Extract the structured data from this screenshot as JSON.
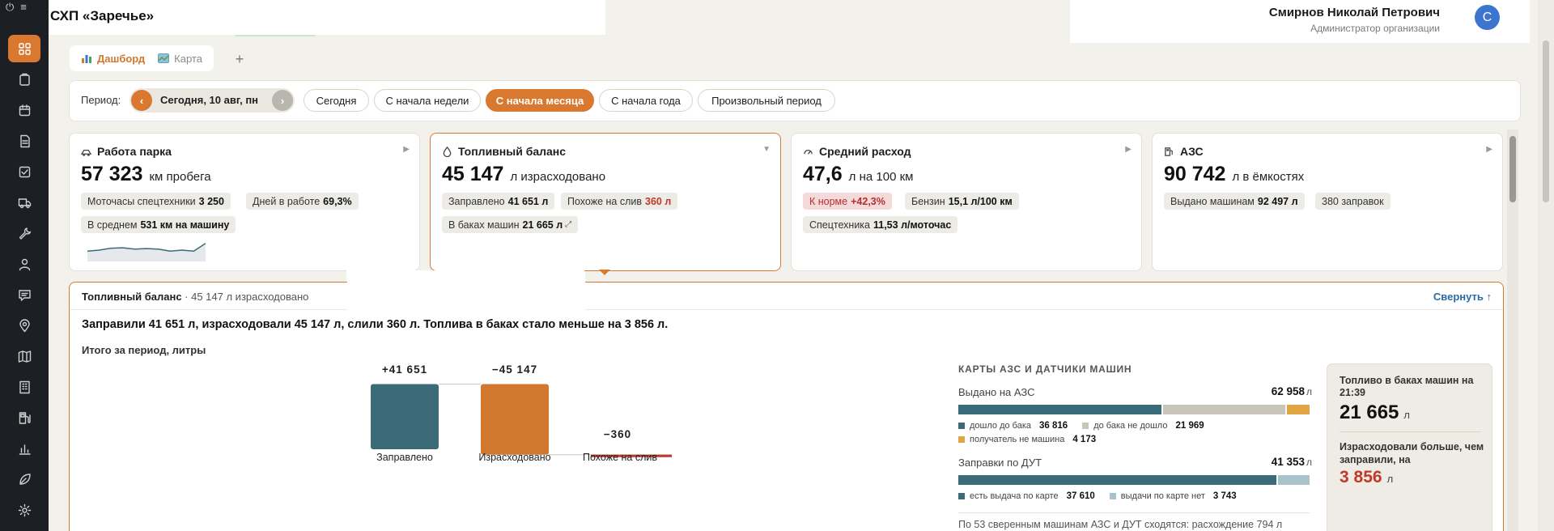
{
  "org": {
    "title": "СХП «Заречье»"
  },
  "user": {
    "name": "Смирнов Николай Петрович",
    "role": "Администратор организации",
    "avatar_letter": "С"
  },
  "sidebar": {
    "icons": [
      "dashboard-icon",
      "clipboard-icon",
      "calendar-icon",
      "document-icon",
      "checklist-icon",
      "truck-icon",
      "wrench-icon",
      "user-icon",
      "chat-icon",
      "location-icon",
      "map-icon",
      "building-icon",
      "fuel-station-icon",
      "bar-chart-icon",
      "leaf-icon",
      "settings-icon"
    ],
    "accent": "#d9782f"
  },
  "tabs": [
    {
      "label": "Дашборд",
      "icon": "bar-chart-icon",
      "active": true
    },
    {
      "label": "Карта",
      "icon": "map-icon",
      "active": false
    }
  ],
  "add_tab_label": "+",
  "period": {
    "label": "Период:",
    "current": "Сегодня, 10 авг, пн",
    "prev": "‹",
    "next": "›",
    "options": [
      "Сегодня",
      "С начала недели",
      "С начала месяца",
      "С начала года",
      "Произвольный период"
    ],
    "active": "С начала месяца"
  },
  "cards": [
    {
      "title": "Работа парка",
      "icon": "fleet-icon",
      "value": "57 323",
      "unit": "км пробега",
      "chips": [
        {
          "label": "Моточасы спецтехники",
          "value": "3 250"
        },
        {
          "label": "Дней в работе",
          "value": "69,3%"
        },
        {
          "label": "В среднем",
          "value": "531 км на машину"
        }
      ],
      "sparkline": [
        0.45,
        0.5,
        0.6,
        0.62,
        0.55,
        0.58,
        0.55,
        0.45,
        0.5,
        0.45,
        0.85
      ]
    },
    {
      "title": "Топливный баланс",
      "icon": "drop-icon",
      "value": "45 147",
      "unit": "л израсходовано",
      "chips": [
        {
          "label": "Заправлено",
          "value": "41 651 л"
        },
        {
          "label": "Похоже на слив",
          "value": "360 л"
        },
        {
          "label": "В баках машин",
          "value": "21 665 л",
          "suffix": "⤢"
        }
      ]
    },
    {
      "title": "Средний расход",
      "icon": "gauge-icon",
      "value": "47,6",
      "unit": "л на 100 км",
      "chips": [
        {
          "label": "К норме",
          "value": "+42,3%"
        },
        {
          "label": "Бензин",
          "value": "15,1 л/100 км"
        },
        {
          "label": "Спецтехника",
          "value": "11,53 л/моточас"
        }
      ]
    },
    {
      "title": "АЗС",
      "icon": "fuel-pump-icon",
      "value": "90 742",
      "unit": "л в ёмкостях",
      "chips": [
        {
          "label": "Выдано машинам",
          "value": "92 497 л"
        },
        {
          "label": "380 заправок",
          "value": ""
        }
      ]
    }
  ],
  "detail": {
    "title": "Топливный баланс",
    "subtitle": "· 45 147 л израсходовано",
    "collapse": "Свернуть ↑",
    "summary": "Заправили 41 651 л, израсходовали 45 147 л, слили 360 л. Топлива в баках стало меньше на 3 856 л.",
    "chart_title": "Итого за период, литры",
    "chart_data": {
      "type": "bar",
      "categories": [
        "Заправлено",
        "Израсходовано",
        "Похоже на слив"
      ],
      "values": [
        41651,
        -45147,
        -360
      ],
      "value_labels": [
        "+41 651",
        "−45 147",
        "−360"
      ],
      "colors": [
        "#3b6a78",
        "#d1772e",
        "#c0392b"
      ]
    },
    "right_panel": {
      "title": "КАРТЫ АЗС И ДАТЧИКИ МАШИН",
      "block1": {
        "label": "Выдано на АЗС",
        "total": "62 958",
        "unit": "л",
        "segments": [
          36816,
          21969,
          4173
        ],
        "legend": [
          {
            "label": "дошло до бака",
            "value": "36 816",
            "color": "#3b6a78"
          },
          {
            "label": "до бака не дошло",
            "value": "21 969",
            "color": "#c9c5bb"
          },
          {
            "label": "получатель не машина",
            "value": "4 173",
            "color": "#e0a443"
          }
        ]
      },
      "block2": {
        "label": "Заправки по ДУТ",
        "total": "41 353",
        "unit": "л",
        "segments": [
          37610,
          3743
        ],
        "legend": [
          {
            "label": "есть выдача по карте",
            "value": "37 610",
            "color": "#3b6a78"
          },
          {
            "label": "выдачи по карте нет",
            "value": "3 743",
            "color": "#a9c3cc"
          }
        ]
      },
      "note": "По 53 сверенным машинам АЗС и ДУТ сходятся: расхождение 794 л"
    },
    "side_card": {
      "label1": "Топливо в баках машин на 21:39",
      "value1": "21 665",
      "unit1": "л",
      "label2": "Израсходовали больше, чем заправили, на",
      "value2": "3 856",
      "unit2": "л"
    }
  }
}
